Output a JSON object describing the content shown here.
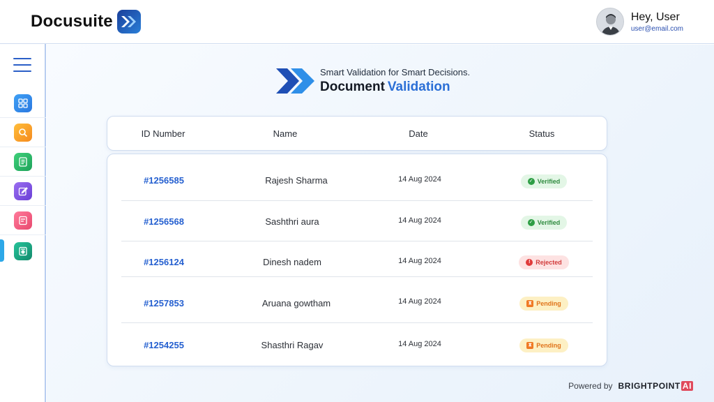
{
  "header": {
    "brand_name": "Docusuite",
    "user_greeting": "Hey, User",
    "user_email": "user@email.com"
  },
  "sidebar": {
    "items": [
      {
        "icon": "dashboard-icon",
        "color_from": "#3fa0f5",
        "color_to": "#2a78e0"
      },
      {
        "icon": "search-icon",
        "color_from": "#ffbe3a",
        "color_to": "#f58a1f"
      },
      {
        "icon": "document-icon",
        "color_from": "#3fd07a",
        "color_to": "#1ea25a"
      },
      {
        "icon": "edit-icon",
        "color_from": "#9a6ef0",
        "color_to": "#6a3fd6"
      },
      {
        "icon": "report-icon",
        "color_from": "#ff7a9a",
        "color_to": "#e8486e"
      },
      {
        "icon": "validation-icon",
        "color_from": "#26c39a",
        "color_to": "#138a6c",
        "active": true
      }
    ]
  },
  "page": {
    "tagline": "Smart Validation for Smart Decisions.",
    "title_part1": "Document",
    "title_part2": "Validation"
  },
  "table": {
    "columns": [
      "ID Number",
      "Name",
      "Date",
      "Status"
    ],
    "rows": [
      {
        "id": "#1256585",
        "name": "Rajesh Sharma",
        "date": "14 Aug 2024",
        "status": "Verified"
      },
      {
        "id": "#1256568",
        "name": "Sashthri aura",
        "date": "14 Aug 2024",
        "status": "Verified"
      },
      {
        "id": "#1256124",
        "name": "Dinesh nadem",
        "date": "14 Aug 2024",
        "status": "Rejected"
      },
      {
        "id": "#1257853",
        "name": "Aruana gowtham",
        "date": "14 Aug 2024",
        "status": "Pending"
      },
      {
        "id": "#1254255",
        "name": "Shasthri Ragav",
        "date": "14 Aug 2024",
        "status": "Pending"
      }
    ]
  },
  "status_colors": {
    "Verified": {
      "bg": "#e3f6e6",
      "fg": "#2e8a3e",
      "dot": "#2e9e45"
    },
    "Rejected": {
      "bg": "#fde2e2",
      "fg": "#d23b3b",
      "dot": "#e03b3b"
    },
    "Pending": {
      "bg": "#fdf0c4",
      "fg": "#e0731a",
      "dot": "#f07a24"
    }
  },
  "footer": {
    "powered_by": "Powered by",
    "brand": "BRIGHTPOINT",
    "brand_suffix": "AI"
  }
}
